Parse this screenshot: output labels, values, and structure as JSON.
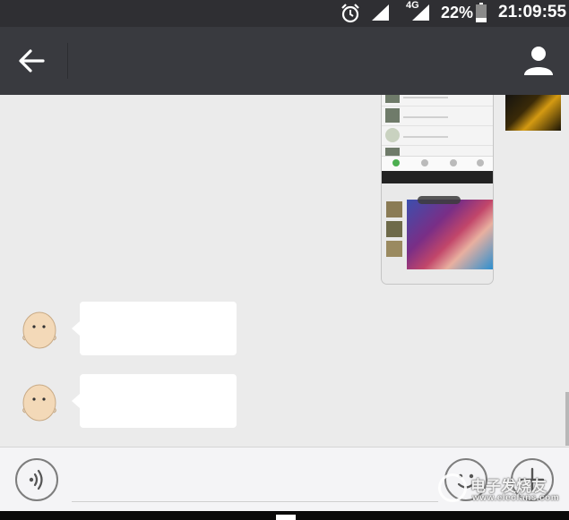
{
  "status_bar": {
    "network_type": "4G",
    "battery_percent": "22%",
    "time": "21:09:55",
    "icons": [
      "alarm-icon",
      "signal-icon",
      "battery-icon"
    ]
  },
  "app_bar": {
    "icons": [
      "arrow-left-icon",
      "person-icon"
    ],
    "background": "#393a3f"
  },
  "messages": [
    {
      "direction": "outgoing",
      "type": "image"
    },
    {
      "direction": "incoming",
      "type": "text",
      "text": ""
    },
    {
      "direction": "incoming",
      "type": "text",
      "text": ""
    }
  ],
  "input_bar": {
    "text_value": "",
    "icons": [
      "voice-icon",
      "emoji-icon",
      "plus-icon"
    ]
  },
  "watermark": {
    "line1": "电子发烧友",
    "line2": "www.elecfans.com"
  },
  "colors": {
    "chat_background": "#ebebeb",
    "bubble": "#ffffff",
    "status_bar": "#2f2f33"
  }
}
